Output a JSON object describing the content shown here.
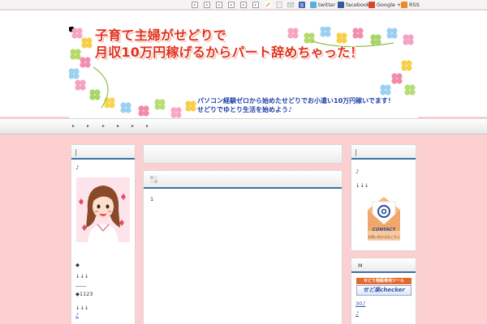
{
  "toolbar": {
    "nav_buttons": [
      "▸",
      "▸",
      "▸",
      "▸",
      "▸",
      "▸"
    ],
    "twitter_label": "twitter",
    "facebook_label": "facebook",
    "google_label": "Google +1",
    "rss_label": "RSS"
  },
  "header": {
    "title_line1": "子育て主婦がせどりで",
    "title_line2": "月収10万円稼げるからパート辞めちゃった！",
    "subtitle_line1": "パソコン経験ゼロから始めたせどりでお小遣い10万円稼いでます！",
    "subtitle_line2": "せどりでゆとり生活を始めよう♪"
  },
  "nav": {
    "items": [
      "▸",
      "▸",
      "▸",
      "▸",
      "▸",
      "▸"
    ]
  },
  "left_sidebar": {
    "note": "♪",
    "bullet1": "◆",
    "arrows1": "↓↓↓",
    "divider": "――",
    "count_label": "◆1123",
    "arrows2": "↓↓↓",
    "link": "♪"
  },
  "main": {
    "post_content": "1"
  },
  "right_sidebar": {
    "note": "♪",
    "arrows": "↓↓↓",
    "contact_word": "CONTACT",
    "contact_sub": "お問い合わせはこちら",
    "section_title": "M",
    "badge1_text": "せどり物販専用ツール",
    "badge2_text": "せど楽checker",
    "link1": "30♪",
    "link2": "♪"
  },
  "colors": {
    "page_bg": "#fcd0d0",
    "accent_blue": "#3f6fa6",
    "title_red": "#e0321e",
    "subtitle_blue": "#1e3fa8"
  }
}
